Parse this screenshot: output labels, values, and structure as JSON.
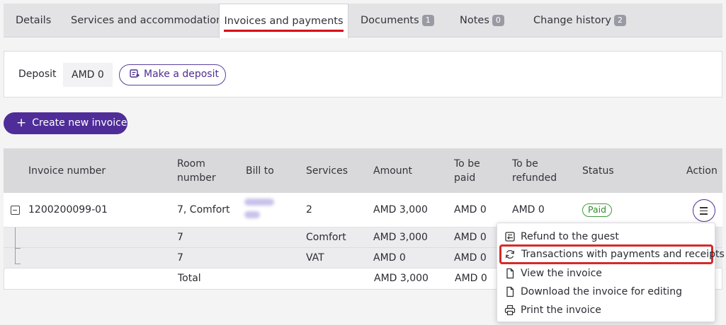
{
  "tabs": [
    {
      "label": "Details"
    },
    {
      "label": "Services and accommodation"
    },
    {
      "label": "Invoices and payments"
    },
    {
      "label": "Documents",
      "badge": "1"
    },
    {
      "label": "Notes",
      "badge": "0"
    },
    {
      "label": "Change history",
      "badge": "2"
    }
  ],
  "deposit": {
    "label": "Deposit",
    "value": "AMD 0",
    "button": "Make a deposit"
  },
  "create_invoice": "Create new invoice",
  "table": {
    "headers": {
      "invoice_number": "Invoice number",
      "room_number_1": "Room",
      "room_number_2": "number",
      "bill_to": "Bill to",
      "services": "Services",
      "amount": "Amount",
      "to_be_paid_1": "To be",
      "to_be_paid_2": "paid",
      "to_be_refunded_1": "To be",
      "to_be_refunded_2": "refunded",
      "status": "Status",
      "action": "Action"
    },
    "invoice": {
      "number": "1200200099-01",
      "room": "7, Comfort",
      "services": "2",
      "amount": "AMD 3,000",
      "to_be_paid": "AMD 0",
      "to_be_refunded": "AMD 0",
      "status": "Paid"
    },
    "items": [
      {
        "room": "7",
        "service": "Comfort",
        "amount": "AMD 3,000",
        "to_be_paid": "AMD 0"
      },
      {
        "room": "7",
        "service": "VAT",
        "amount": "AMD 0",
        "to_be_paid": "AMD 0"
      }
    ],
    "total": {
      "label": "Total",
      "amount": "AMD 3,000",
      "to_be_paid": "AMD 0"
    }
  },
  "action_menu": [
    {
      "label": "Refund to the guest",
      "icon": "refund-icon"
    },
    {
      "label": "Transactions with payments and receipts",
      "icon": "refresh-icon"
    },
    {
      "label": "View the invoice",
      "icon": "document-icon"
    },
    {
      "label": "Download the invoice for editing",
      "icon": "document-icon"
    },
    {
      "label": "Print the invoice",
      "icon": "printer-icon"
    }
  ],
  "colors": {
    "accent": "#4f2d99",
    "active_tab_underline": "#d9001b",
    "paid": "#2f8c2a",
    "highlight": "#d42a2a"
  }
}
